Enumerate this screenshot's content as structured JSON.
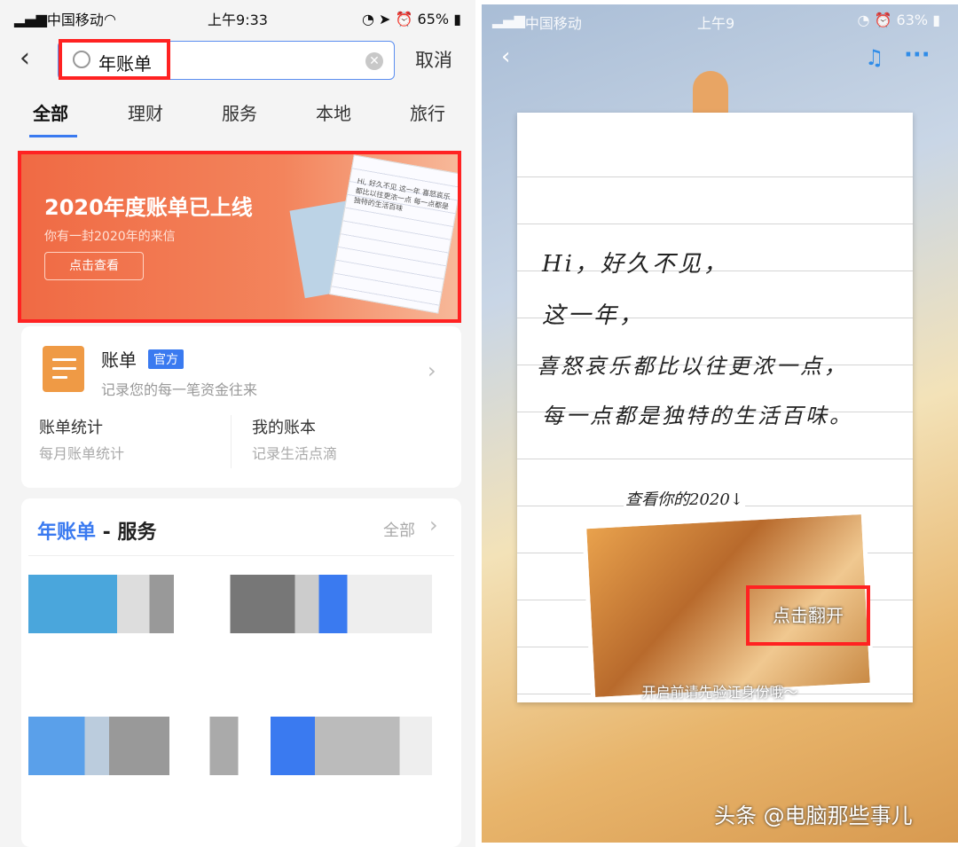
{
  "left": {
    "status": {
      "carrier": "中国移动",
      "time": "上午9:33",
      "battery": "65%"
    },
    "search": {
      "value": "年账单",
      "cancel": "取消"
    },
    "tabs": [
      "全部",
      "理财",
      "服务",
      "本地",
      "旅行"
    ],
    "banner": {
      "title": "2020年度账单已上线",
      "subtitle": "你有一封2020年的来信",
      "button": "点击查看",
      "letter_text": "Hi, 好久不见 这一年 喜怒哀乐都比以往更浓一点 每一点都是独特的生活百味"
    },
    "bill": {
      "title": "账单",
      "badge": "官方",
      "desc": "记录您的每一笔资金往来",
      "links": [
        {
          "title": "账单统计",
          "sub": "每月账单统计"
        },
        {
          "title": "我的账本",
          "sub": "记录生活点滴"
        }
      ]
    },
    "services": {
      "title_highlight": "年账单",
      "title_rest": " - 服务",
      "all": "全部"
    },
    "colors": {
      "accent": "#3a7af0",
      "highlight": "#ff2222",
      "banner": "#f06a44"
    }
  },
  "right": {
    "status": {
      "carrier": "中国移动",
      "time": "上午9",
      "battery": "63%"
    },
    "letter_lines": [
      "Hi，好久不见，",
      "这一年，",
      "喜怒哀乐都比以往更浓一点，",
      "每一点都是独特的生活百味。"
    ],
    "view_label": "查看你的2020↓",
    "flip_button": "点击翻开",
    "verify_note": "开启前请先验证身份哦～",
    "watermark": "头条 @电脑那些事儿"
  }
}
